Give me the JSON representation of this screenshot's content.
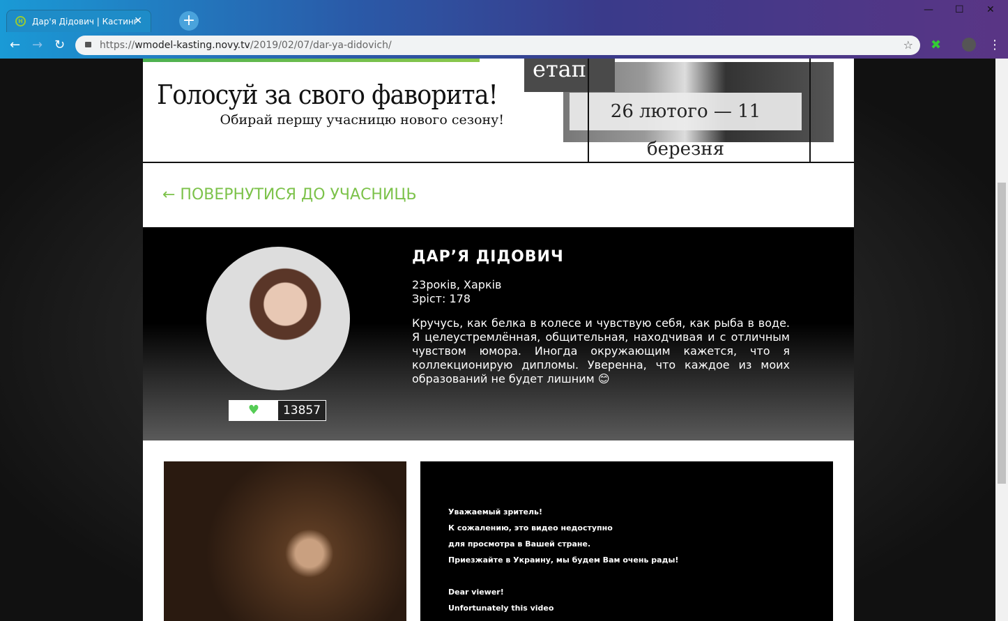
{
  "browser": {
    "tab_title": "Дар'я Дідович | Кастинг",
    "url_scheme": "https://",
    "url_host": "wmodel-kasting.novy.tv",
    "url_path": "/2019/02/07/dar-ya-didovich/"
  },
  "banner": {
    "title": "Голосуй за свого фаворита!",
    "subtitle": "Обирай першу учасницю нового сезону!",
    "stage": "етап",
    "dates": "26 лютого — 11 березня"
  },
  "back_link": "← ПОВЕРНУТИСЯ ДО УЧАСНИЦЬ",
  "profile": {
    "name": "ДАР’Я ДІДОВИЧ",
    "age_city": "23років, Харків",
    "height": "Зріст: 178",
    "bio": "Кручусь, как белка в колесе и чувствую себя, как рыба в воде. Я целеустремлённая, общительная, находчивая и с отличным чувством юмора. Иногда окружающим кажется, что я коллекционирую дипломы. Уверенна, что каждое из моих образований не будет лишним 😊",
    "likes": "13857"
  },
  "video_message": [
    "Уважаемый зритель!",
    "К сожалению, это видео недоступно",
    "для просмотра в Вашей стране.",
    "Приезжайте в Украину, мы будем Вам очень рады!",
    "",
    "Dear viewer!",
    "Unfortunately this video"
  ],
  "colors": {
    "accent": "#7cc24a"
  }
}
